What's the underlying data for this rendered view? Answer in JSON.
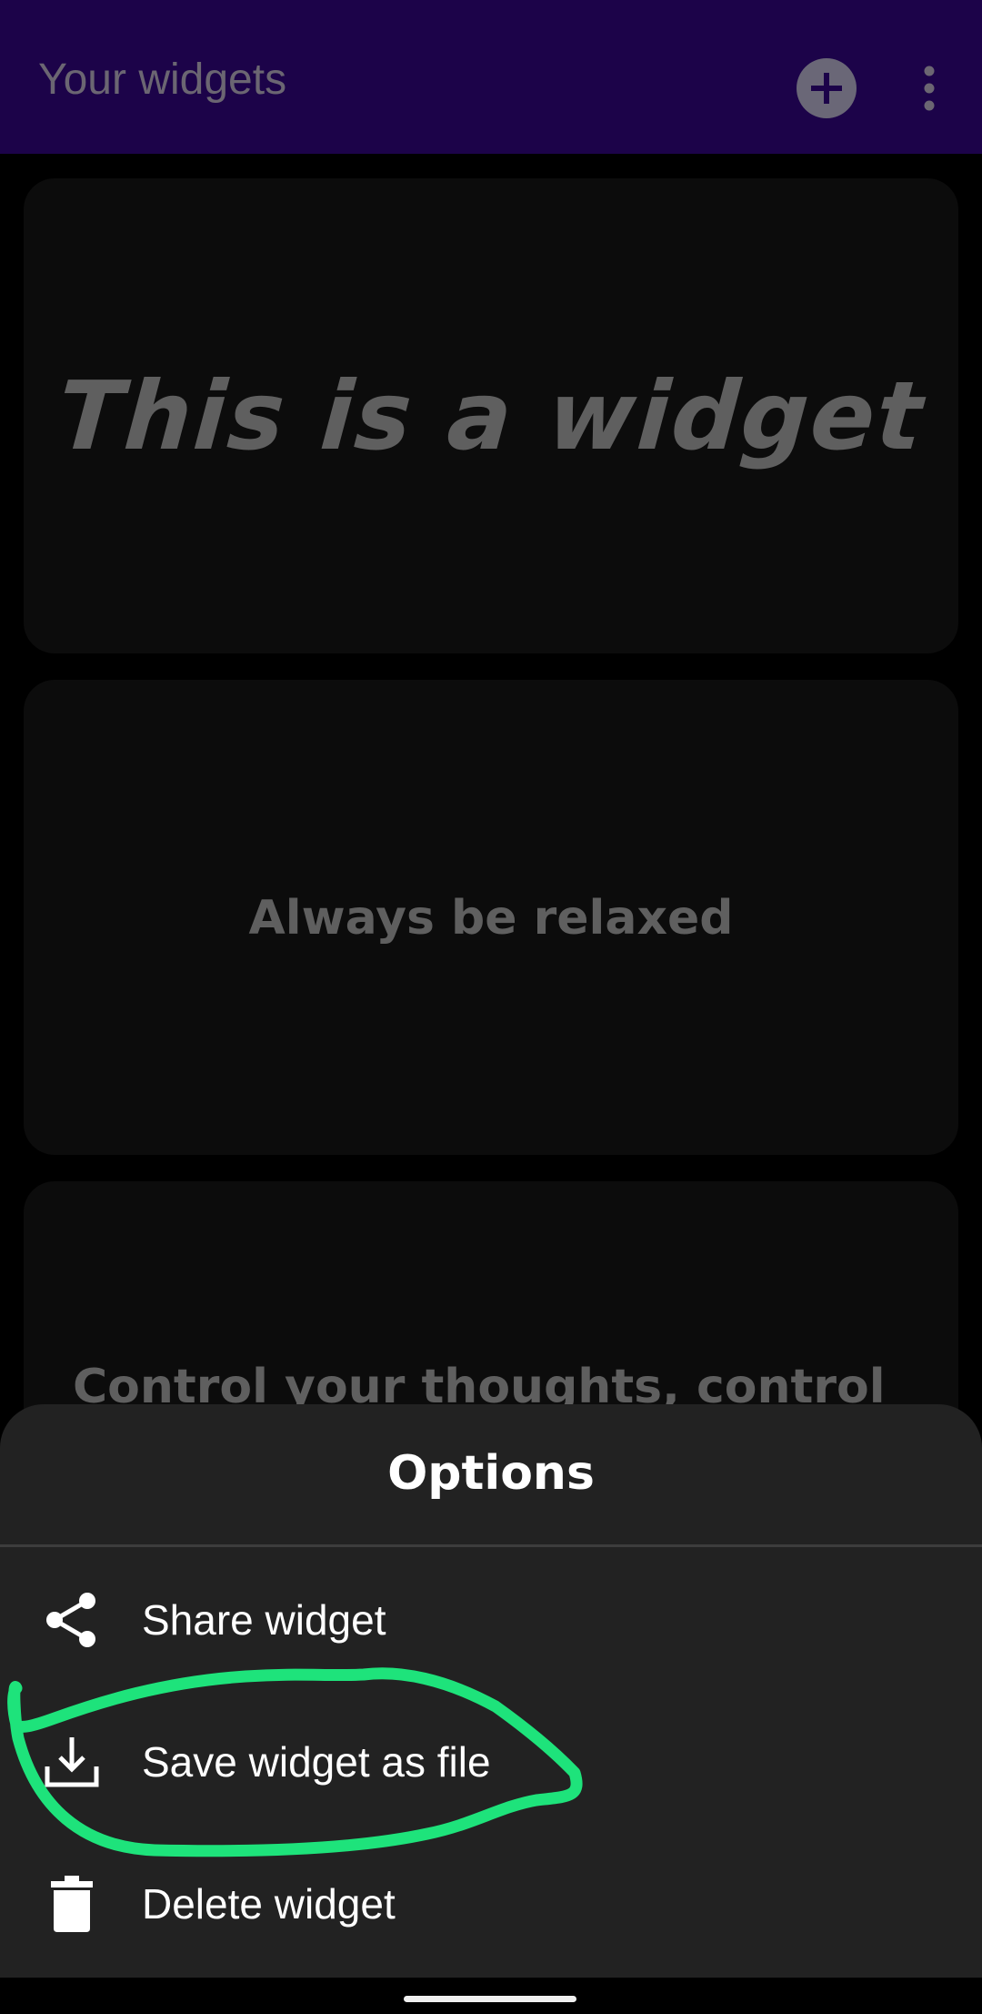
{
  "app_bar": {
    "title": "Your widgets",
    "add_icon": "plus-circle-icon",
    "more_icon": "more-vert-icon"
  },
  "widgets": [
    {
      "text": "This is a widget"
    },
    {
      "text": "Always be relaxed"
    },
    {
      "text": "Control your thoughts, control"
    }
  ],
  "sheet": {
    "title": "Options",
    "options": [
      {
        "label": "Share widget",
        "icon": "share-icon"
      },
      {
        "label": "Save widget as file",
        "icon": "download-icon"
      },
      {
        "label": "Delete widget",
        "icon": "trash-icon"
      }
    ]
  },
  "colors": {
    "app_bar": "#1c0349",
    "sheet": "#222222",
    "annotation": "#1ee37b"
  }
}
